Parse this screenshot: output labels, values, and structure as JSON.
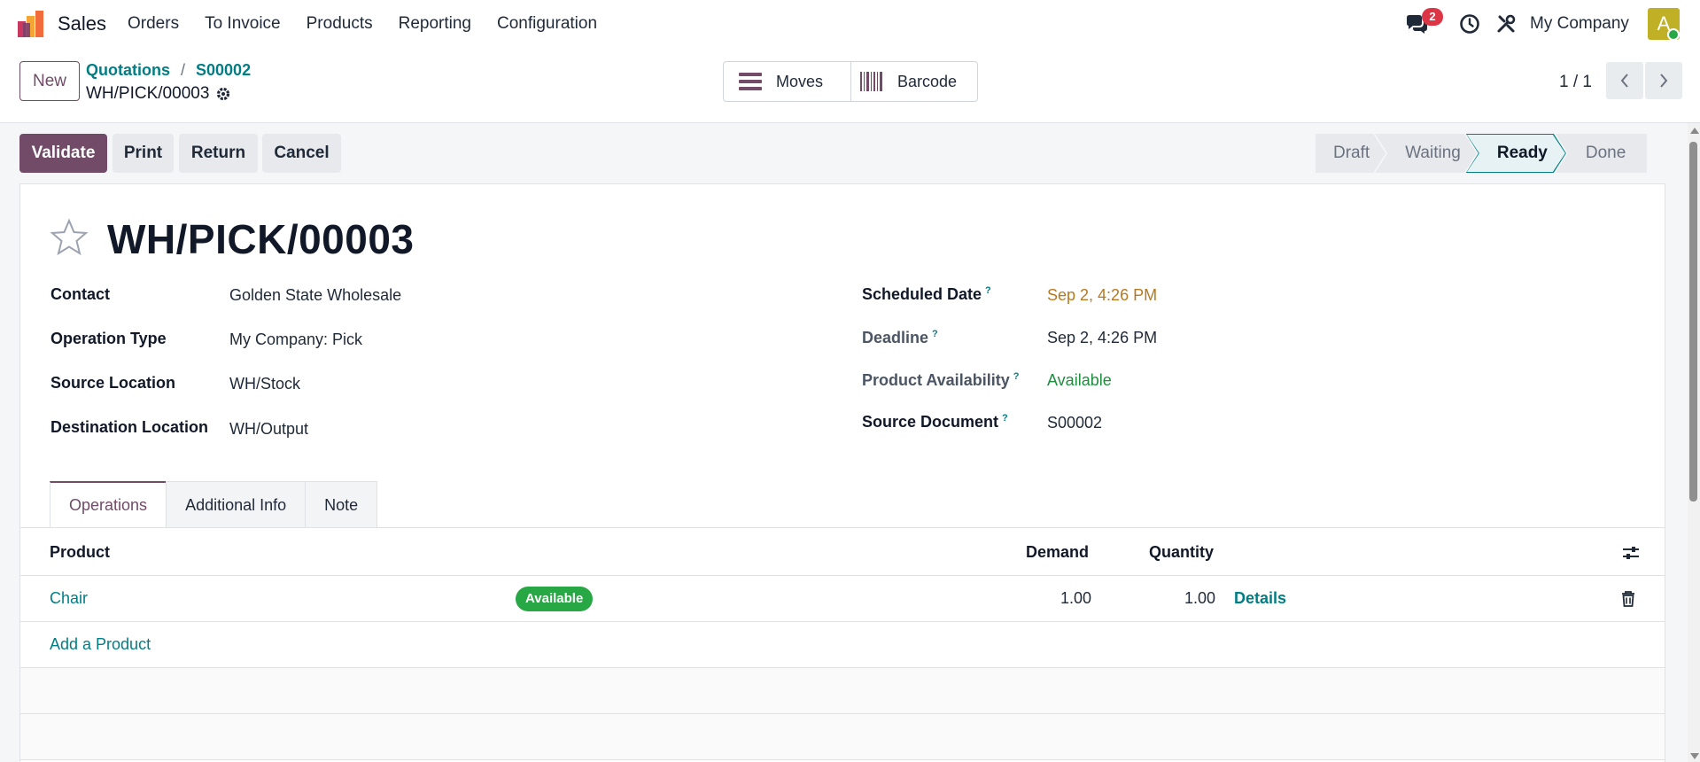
{
  "nav": {
    "app_name": "Sales",
    "menu": [
      "Orders",
      "To Invoice",
      "Products",
      "Reporting",
      "Configuration"
    ],
    "chat_badge": "2",
    "company": "My Company",
    "avatar_initial": "A",
    "avatar_color": "#c0b026"
  },
  "control": {
    "new_label": "New",
    "breadcrumb": [
      "Quotations",
      "S00002"
    ],
    "record_name": "WH/PICK/00003",
    "smart_buttons": {
      "moves": "Moves",
      "barcode": "Barcode"
    },
    "pager": "1 / 1"
  },
  "actions": {
    "validate": "Validate",
    "print": "Print",
    "return": "Return",
    "cancel": "Cancel"
  },
  "status": {
    "stages": [
      "Draft",
      "Waiting",
      "Ready",
      "Done"
    ],
    "current": "Ready"
  },
  "form": {
    "title": "WH/PICK/00003",
    "left": [
      {
        "label": "Contact",
        "value": "Golden State Wholesale"
      },
      {
        "label": "Operation Type",
        "value": "My Company: Pick"
      },
      {
        "label": "Source Location",
        "value": "WH/Stock"
      },
      {
        "label": "Destination Location",
        "value": "WH/Output"
      }
    ],
    "right": [
      {
        "label": "Scheduled Date",
        "help": "?",
        "value": "Sep 2, 4:26 PM"
      },
      {
        "label": "Deadline",
        "help": "?",
        "value": "Sep 2, 4:26 PM"
      },
      {
        "label": "Product Availability",
        "help": "?",
        "value": "Available"
      },
      {
        "label": "Source Document",
        "help": "?",
        "value": "S00002"
      }
    ]
  },
  "tabs": [
    "Operations",
    "Additional Info",
    "Note"
  ],
  "table": {
    "headers": {
      "product": "Product",
      "demand": "Demand",
      "quantity": "Quantity"
    },
    "rows": [
      {
        "product": "Chair",
        "badge": "Available",
        "demand": "1.00",
        "quantity": "1.00",
        "details": "Details"
      }
    ],
    "add_product": "Add a Product"
  },
  "colors": {
    "primary": "#714b67",
    "link": "#017e84",
    "success": "#28a745",
    "warning": "#b7791f",
    "badge": "#dc3545"
  }
}
